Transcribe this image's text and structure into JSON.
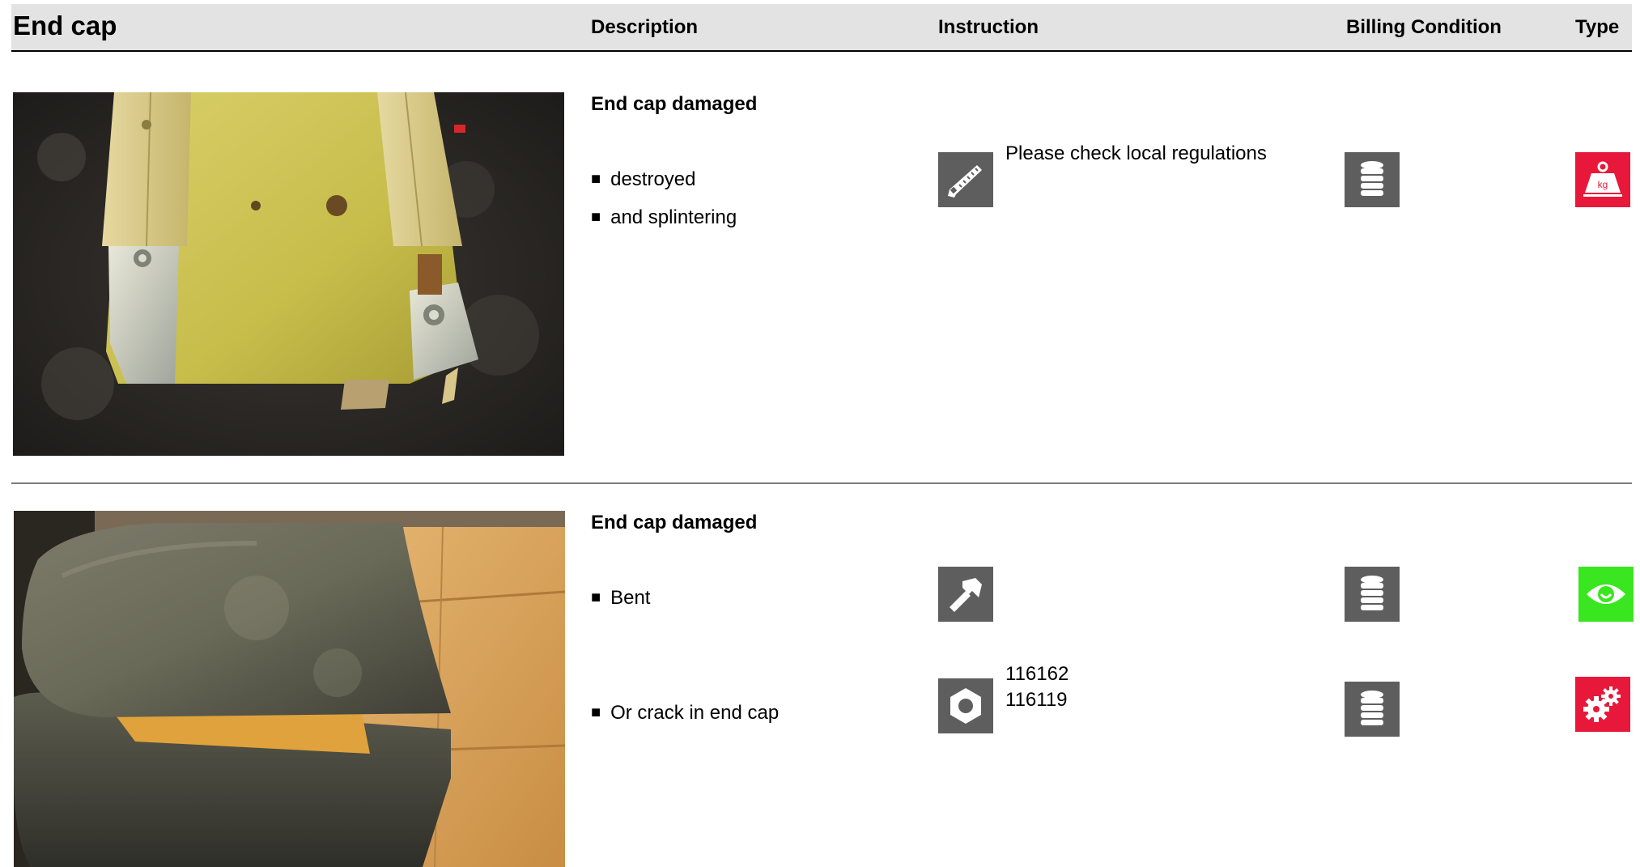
{
  "header": {
    "title": "End cap",
    "columns": {
      "description": "Description",
      "instruction": "Instruction",
      "billing": "Billing Condition",
      "type": "Type"
    }
  },
  "rows": [
    {
      "description_title": "End cap damaged",
      "items": [
        {
          "bullets": [
            "destroyed",
            "and splintering"
          ],
          "instruction_icon": "saw-icon",
          "instruction_text": "Please check local regulations",
          "billing_icon": "coin-stack-icon",
          "type_icon": "weight-kg-icon"
        }
      ]
    },
    {
      "description_title": "End cap damaged",
      "items": [
        {
          "bullets": [
            "Bent"
          ],
          "instruction_icon": "hammer-icon",
          "instruction_text": "",
          "billing_icon": "coin-stack-icon",
          "type_icon": "eye-icon"
        },
        {
          "bullets": [
            "Or crack in end cap"
          ],
          "instruction_icon": "nut-icon",
          "instruction_text": "116162\n116119",
          "part_numbers": [
            "116162",
            "116119"
          ],
          "billing_icon": "coin-stack-icon",
          "type_icon": "gears-icon"
        }
      ]
    }
  ],
  "bullet_symbol": "■",
  "colors": {
    "icon_gray": "#5e5e5e",
    "type_red": "#e8183a",
    "type_green": "#39e61f",
    "header_bg": "#e3e3e3"
  }
}
